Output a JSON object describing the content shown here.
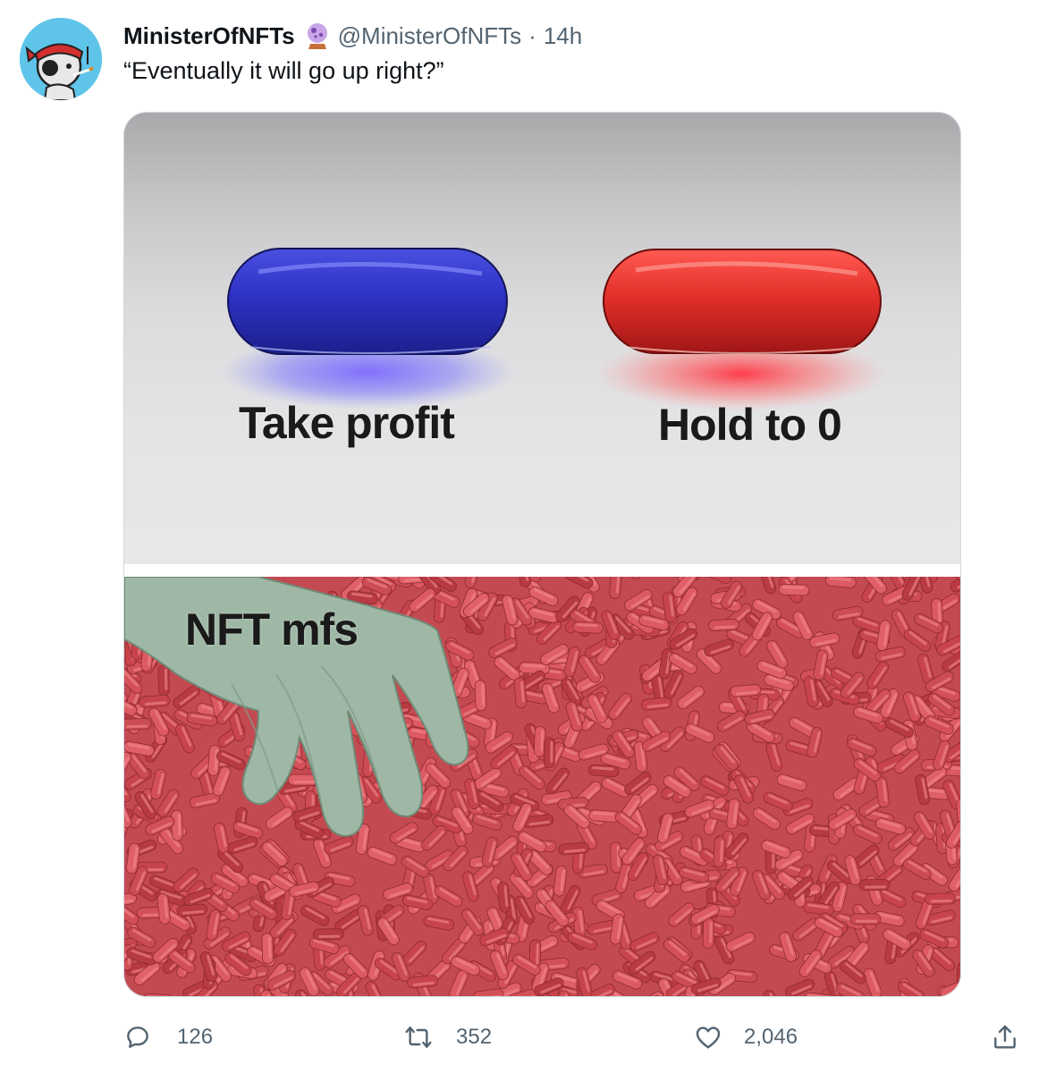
{
  "tweet": {
    "display_name": "MinisterOfNFTs",
    "handle": "@MinisterOfNFTs",
    "separator": "·",
    "time": "14h",
    "text": "“Eventually it will go up right?”"
  },
  "meme": {
    "top_left_caption": "Take profit",
    "top_right_caption": "Hold to 0",
    "bottom_caption": "NFT mfs"
  },
  "actions": {
    "replies": "126",
    "retweets": "352",
    "likes": "2,046"
  },
  "icons": {
    "avatar": "avatar",
    "badge": "crystal-ball-icon",
    "reply": "reply-icon",
    "retweet": "retweet-icon",
    "like": "heart-icon",
    "share": "share-icon"
  },
  "colors": {
    "secondary_text": "#536471",
    "primary_text": "#0f1419",
    "avatar_bg": "#5fc4ea"
  }
}
